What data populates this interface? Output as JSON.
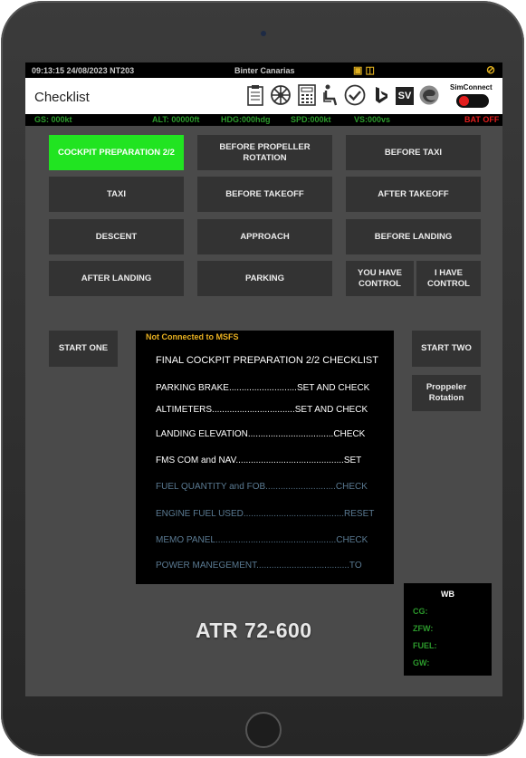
{
  "statusbar": {
    "time_date_flight": "09:13:15  24/08/2023  NT203",
    "airline": "Binter Canarias",
    "status_icons": "▣ ◫",
    "no_icon": "⊘"
  },
  "header": {
    "title": "Checklist",
    "icons": [
      "clipboard-icon",
      "wheel-icon",
      "calculator-icon",
      "seat-icon",
      "check-circle-icon",
      "bing-icon",
      "sv-icon",
      "edge-icon"
    ],
    "sv_label": "SV",
    "simconnect_label": "SimConnect",
    "simconnect_connected": false,
    "colors": {
      "toggle_off": "#e21d1d"
    }
  },
  "infobar": {
    "gs": "GS:  000kt",
    "alt": "ALT:  00000ft",
    "hdg": "HDG:000hdg",
    "spd": "SPD:000kt",
    "vs": "VS:000vs",
    "bat": "BAT OFF"
  },
  "checklist_buttons": [
    "COCKPIT PREPARATION 2/2",
    "BEFORE PROPELLER ROTATION",
    "BEFORE TAXI",
    "TAXI",
    "BEFORE TAKEOFF",
    "AFTER TAKEOFF",
    "DESCENT",
    "APPROACH",
    "BEFORE LANDING",
    "AFTER LANDING",
    "PARKING"
  ],
  "active_button": "COCKPIT PREPARATION 2/2",
  "control": {
    "you_have": "YOU HAVE CONTROL",
    "i_have": "I HAVE CONTROL"
  },
  "start_one": "START ONE",
  "start_two": "START TWO",
  "propeller_rotation": "Proppeler Rotation",
  "checklist": {
    "status": "Not Connected to MSFS",
    "title": "FINAL COCKPIT PREPARATION 2/2 CHECKLIST",
    "items": [
      {
        "text": "PARKING BRAKE...........................SET AND CHECK",
        "done": true
      },
      {
        "text": "ALTIMETERS.................................SET AND CHECK",
        "done": true
      },
      {
        "text": "LANDING ELEVATION..................................CHECK",
        "done": true
      },
      {
        "text": "FMS COM and NAV...........................................SET",
        "done": true
      },
      {
        "text": "FUEL QUANTITY and FOB............................CHECK",
        "done": false
      },
      {
        "text": "ENGINE FUEL USED........................................RESET",
        "done": false
      },
      {
        "text": "MEMO PANEL................................................CHECK",
        "done": false
      },
      {
        "text": "POWER MANEGEMENT.....................................TO",
        "done": false
      }
    ]
  },
  "wb": {
    "title": "WB",
    "cg": "CG:",
    "zfw": "ZFW:",
    "fuel": "FUEL:",
    "gw": "GW:"
  },
  "aircraft": "ATR 72-600",
  "colors": {
    "active": "#21e421",
    "button": "#333333",
    "panel_bg": "#4a4a4a",
    "info_green": "#2c9a2c",
    "warning_red": "#e21d1d",
    "status_amber": "#e8b020"
  }
}
